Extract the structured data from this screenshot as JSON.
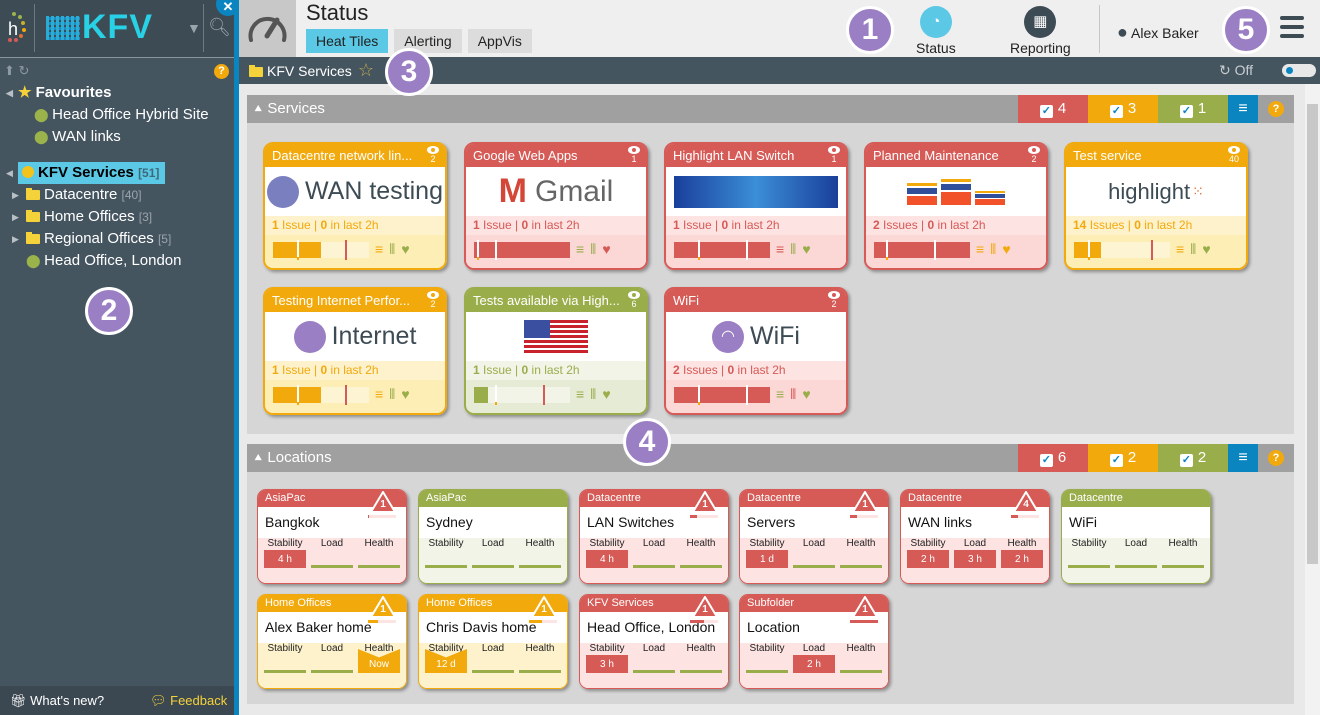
{
  "sidebar": {
    "logo_text": "KFV",
    "favourites_label": "Favourites",
    "favourites": [
      "Head Office Hybrid Site",
      "WAN links"
    ],
    "root": {
      "label": "KFV Services",
      "count": "[51]"
    },
    "folders": [
      {
        "label": "Datacentre",
        "count": "[40]"
      },
      {
        "label": "Home Offices",
        "count": "[3]"
      },
      {
        "label": "Regional Offices",
        "count": "[5]"
      }
    ],
    "location": "Head Office, London",
    "whats_new": "What's new?",
    "feedback": "Feedback"
  },
  "callouts": [
    "1",
    "2",
    "3",
    "4",
    "5"
  ],
  "topbar": {
    "title": "Status",
    "tabs": [
      {
        "label": "Heat Tiles",
        "active": true
      },
      {
        "label": "Alerting"
      },
      {
        "label": "AppVis"
      }
    ],
    "nav": [
      {
        "label": "Status",
        "icon": "gauge-icon"
      },
      {
        "label": "Reporting",
        "icon": "calendar-icon"
      }
    ],
    "user": "Alex Baker"
  },
  "breadcrumb": {
    "label": "KFV Services",
    "refresh_state": "Off"
  },
  "services": {
    "title": "Services",
    "counts": {
      "red": "4",
      "orange": "3",
      "green": "1"
    },
    "tiles": [
      {
        "title": "Datacentre network lin...",
        "watchers": "2",
        "logo": "WAN testing",
        "issues_n": "1",
        "issues": "Issue",
        "last": "0",
        "color": "orange"
      },
      {
        "title": "Google Web Apps",
        "watchers": "1",
        "logo": "Gmail",
        "issues_n": "1",
        "issues": "Issue",
        "last": "0",
        "color": "red"
      },
      {
        "title": "Highlight LAN Switch",
        "watchers": "1",
        "logo": "",
        "issues_n": "1",
        "issues": "Issue",
        "last": "0",
        "color": "red"
      },
      {
        "title": "Planned Maintenance",
        "watchers": "2",
        "logo": "",
        "issues_n": "2",
        "issues": "Issues",
        "last": "0",
        "color": "red"
      },
      {
        "title": "Test service",
        "watchers": "40",
        "logo": "highlight",
        "issues_n": "14",
        "issues": "Issues",
        "last": "0",
        "color": "orange"
      },
      {
        "title": "Testing Internet Perfor...",
        "watchers": "2",
        "logo": "Internet",
        "issues_n": "1",
        "issues": "Issue",
        "last": "0",
        "color": "orange"
      },
      {
        "title": "Tests available via High...",
        "watchers": "6",
        "logo": "",
        "issues_n": "1",
        "issues": "Issue",
        "last": "0",
        "color": "green"
      },
      {
        "title": "WiFi",
        "watchers": "2",
        "logo": "WiFi",
        "issues_n": "2",
        "issues": "Issues",
        "last": "0",
        "color": "red"
      }
    ],
    "in_last": "in last 2h"
  },
  "locations": {
    "title": "Locations",
    "counts": {
      "red": "6",
      "orange": "2",
      "green": "2"
    },
    "metric_labels": [
      "Stability",
      "Load",
      "Health"
    ],
    "tiles": [
      {
        "group": "AsiaPac",
        "name": "Bangkok",
        "alerts": "1",
        "color": "red",
        "metrics": [
          "4 h",
          "",
          ""
        ]
      },
      {
        "group": "AsiaPac",
        "name": "Sydney",
        "alerts": "",
        "color": "green",
        "metrics": [
          "",
          "",
          ""
        ]
      },
      {
        "group": "Datacentre",
        "name": "LAN Switches",
        "alerts": "1",
        "color": "red",
        "metrics": [
          "4 h",
          "",
          ""
        ]
      },
      {
        "group": "Datacentre",
        "name": "Servers",
        "alerts": "1",
        "color": "red",
        "metrics": [
          "1 d",
          "",
          ""
        ]
      },
      {
        "group": "Datacentre",
        "name": "WAN links",
        "alerts": "4",
        "color": "red",
        "metrics": [
          "2 h",
          "3 h",
          "2 h"
        ]
      },
      {
        "group": "Datacentre",
        "name": "WiFi",
        "alerts": "",
        "color": "green",
        "metrics": [
          "",
          "",
          ""
        ]
      },
      {
        "group": "Home Offices",
        "name": "Alex Baker home",
        "alerts": "1",
        "color": "orange",
        "metrics": [
          "",
          "",
          "Now"
        ]
      },
      {
        "group": "Home Offices",
        "name": "Chris Davis home",
        "alerts": "1",
        "color": "orange",
        "metrics": [
          "12 d",
          "",
          ""
        ]
      },
      {
        "group": "KFV Services",
        "name": "Head Office, London",
        "alerts": "1",
        "color": "red",
        "metrics": [
          "3 h",
          "",
          ""
        ]
      },
      {
        "group": "Subfolder",
        "name": "Location",
        "alerts": "1",
        "color": "red",
        "metrics": [
          "",
          "2 h",
          ""
        ]
      }
    ]
  },
  "colors": {
    "red": "#d65a56",
    "orange": "#f2a90c",
    "green": "#9aad4b",
    "blue": "#0a85c0",
    "cyan": "#5bc8e6",
    "sidebar": "#455560"
  }
}
